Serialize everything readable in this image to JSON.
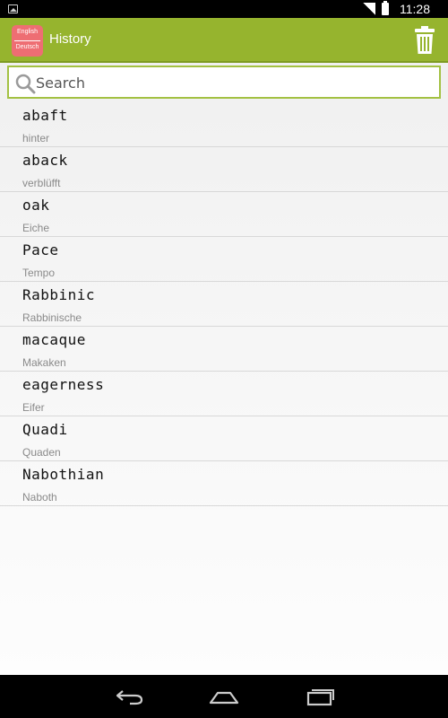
{
  "status_bar": {
    "time": "11:28",
    "icons": [
      "image-notification-icon",
      "wifi-icon",
      "battery-icon"
    ]
  },
  "action_bar": {
    "logo_top": "English",
    "logo_bottom": "Deutsch",
    "title": "History",
    "colors": {
      "background": "#96b42e",
      "logo": "#ee6e73"
    },
    "action_icon": "trash-icon"
  },
  "search": {
    "placeholder": "Search",
    "value": ""
  },
  "history": [
    {
      "word": "abaft",
      "translation": "hinter"
    },
    {
      "word": "aback",
      "translation": "verblüfft"
    },
    {
      "word": "oak",
      "translation": "Eiche"
    },
    {
      "word": "Pace",
      "translation": "Tempo"
    },
    {
      "word": "Rabbinic",
      "translation": "Rabbinische"
    },
    {
      "word": "macaque",
      "translation": "Makaken"
    },
    {
      "word": "eagerness",
      "translation": "Eifer"
    },
    {
      "word": "Quadi",
      "translation": "Quaden"
    },
    {
      "word": "Nabothian",
      "translation": "Naboth"
    }
  ],
  "nav_bar": {
    "icons": [
      "back-icon",
      "home-icon",
      "recent-apps-icon"
    ]
  }
}
